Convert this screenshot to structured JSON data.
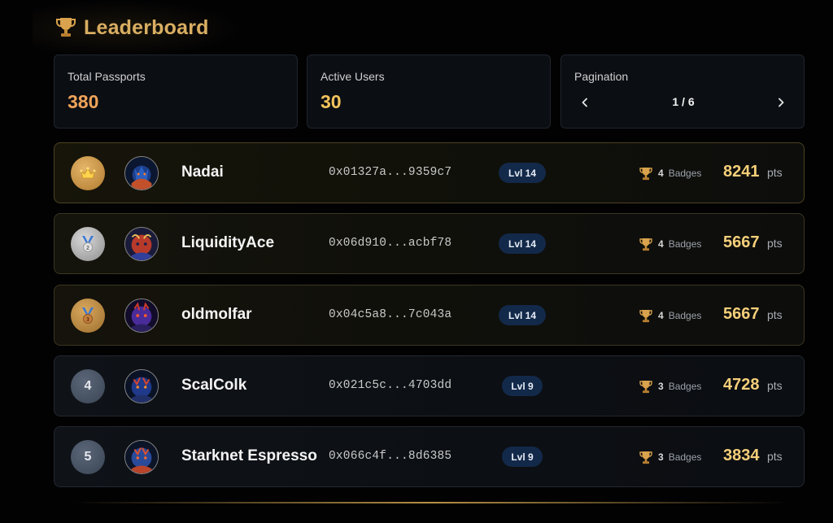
{
  "header": {
    "title": "Leaderboard",
    "icon": "trophy-icon"
  },
  "stats": {
    "total_passports": {
      "label": "Total Passports",
      "value": "380"
    },
    "active_users": {
      "label": "Active Users",
      "value": "30"
    },
    "pagination": {
      "label": "Pagination",
      "indicator": "1 / 6"
    }
  },
  "rows": [
    {
      "rank": "",
      "rank_type": "gold",
      "rank_icon": "crown-icon",
      "name": "Nadai",
      "address": "0x01327a...9359c7",
      "level": "Lvl 14",
      "badges_count": "4",
      "badges_label": "Badges",
      "points": "8241",
      "points_unit": "pts"
    },
    {
      "rank": "",
      "rank_type": "silver",
      "rank_icon": "silver-medal-icon",
      "name": "LiquidityAce",
      "address": "0x06d910...acbf78",
      "level": "Lvl 14",
      "badges_count": "4",
      "badges_label": "Badges",
      "points": "5667",
      "points_unit": "pts"
    },
    {
      "rank": "",
      "rank_type": "bronze",
      "rank_icon": "bronze-medal-icon",
      "name": "oldmolfar",
      "address": "0x04c5a8...7c043a",
      "level": "Lvl 14",
      "badges_count": "4",
      "badges_label": "Badges",
      "points": "5667",
      "points_unit": "pts"
    },
    {
      "rank": "4",
      "rank_type": "plain",
      "rank_icon": "",
      "name": "ScalColk",
      "address": "0x021c5c...4703dd",
      "level": "Lvl 9",
      "badges_count": "3",
      "badges_label": "Badges",
      "points": "4728",
      "points_unit": "pts"
    },
    {
      "rank": "5",
      "rank_type": "plain",
      "rank_icon": "",
      "name": "Starknet Espresso",
      "address": "0x066c4f...8d6385",
      "level": "Lvl 9",
      "badges_count": "3",
      "badges_label": "Badges",
      "points": "3834",
      "points_unit": "pts"
    }
  ],
  "colors": {
    "title": "#d9ae62",
    "total_passports_value": "#f0a35a",
    "active_users_value": "#f3c35c",
    "points": "#f5cf7a",
    "level_pill": "#13294a"
  }
}
